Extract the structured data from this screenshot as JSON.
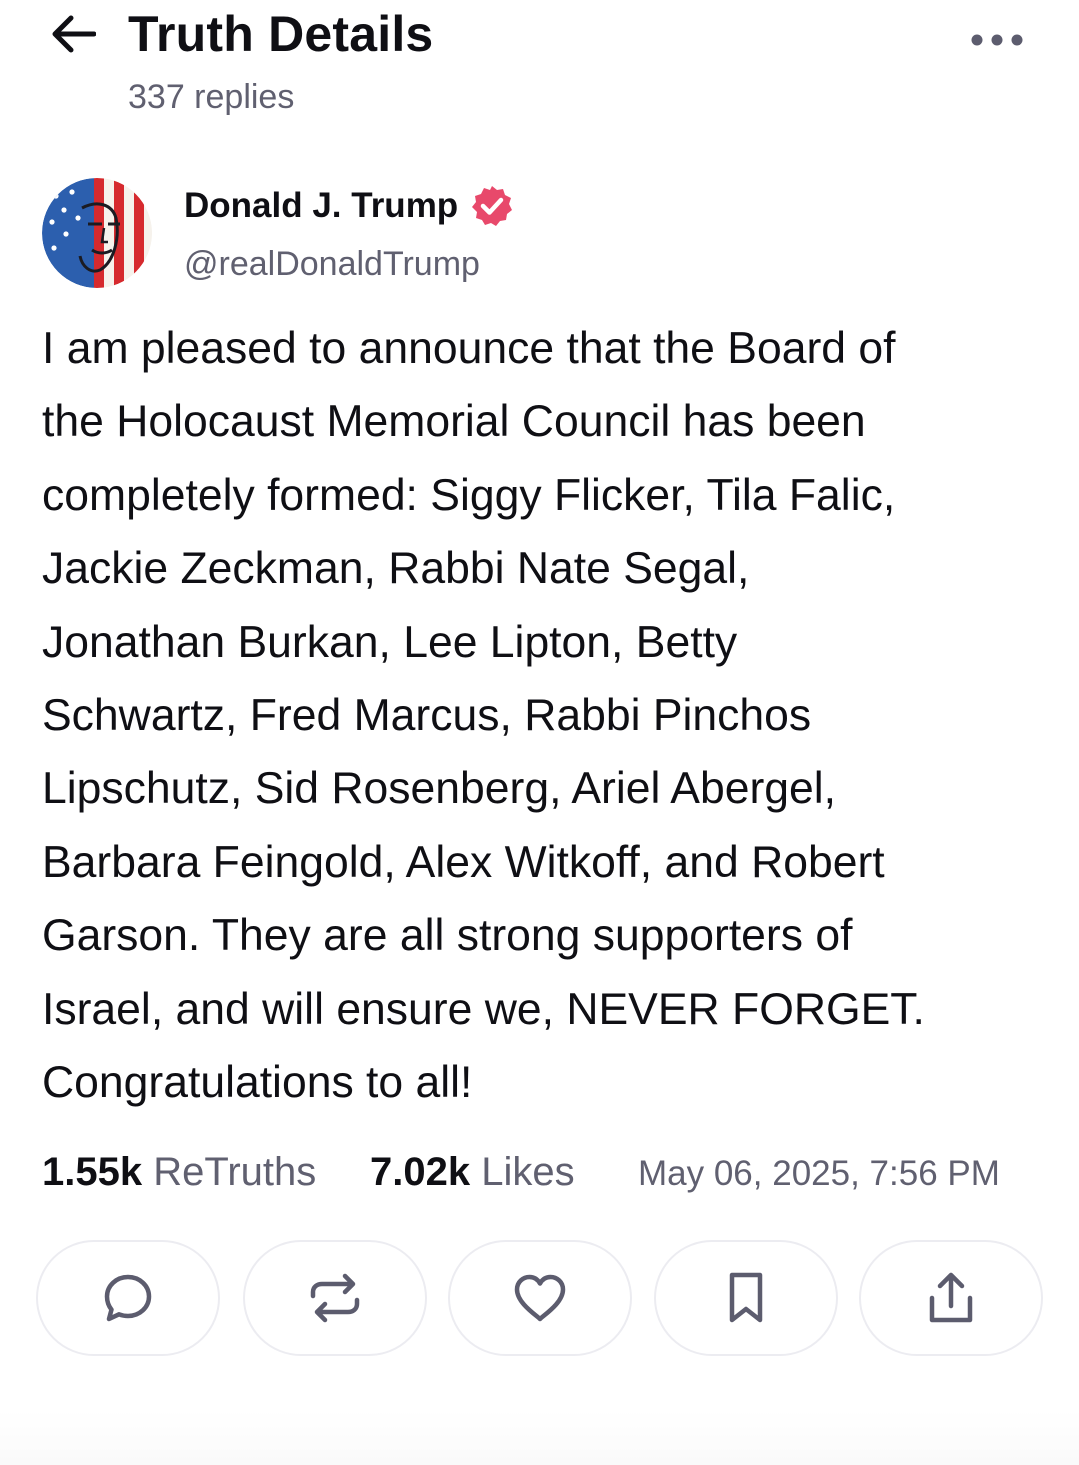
{
  "header": {
    "back_icon": "arrow-left-icon",
    "title": "Truth Details",
    "replies": "337 replies",
    "more_icon": "ellipsis-horizontal-icon"
  },
  "post": {
    "author": {
      "name": "Donald J. Trump",
      "handle": "@realDonaldTrump",
      "verified_icon": "verified-badge-icon",
      "verified_color": "#e8496b"
    },
    "body_lines": [
      "I am pleased to announce that the Board of",
      "the Holocaust Memorial Council has been",
      "completely formed: Siggy Flicker, Tila Falic,",
      "Jackie Zeckman, Rabbi Nate Segal,",
      "Jonathan Burkan, Lee Lipton, Betty",
      "Schwartz, Fred Marcus, Rabbi Pinchos",
      "Lipschutz, Sid Rosenberg, Ariel Abergel,",
      "Barbara Feingold, Alex Witkoff, and Robert",
      "Garson. They are all strong supporters of",
      "Israel, and will ensure we, NEVER FORGET.",
      "Congratulations to all!"
    ],
    "stats": {
      "retruths_count": "1.55k",
      "retruths_label": "ReTruths",
      "likes_count": "7.02k",
      "likes_label": "Likes"
    },
    "timestamp": "May 06, 2025, 7:56 PM"
  },
  "actions": [
    {
      "name": "reply-button",
      "icon": "comment-bubble-icon"
    },
    {
      "name": "retruth-button",
      "icon": "repost-arrows-icon"
    },
    {
      "name": "like-button",
      "icon": "heart-icon"
    },
    {
      "name": "bookmark-button",
      "icon": "bookmark-icon"
    },
    {
      "name": "share-button",
      "icon": "share-upload-icon"
    }
  ],
  "colors": {
    "text_primary": "#0f0f14",
    "text_secondary": "#606070",
    "button_border": "#ececf1",
    "icon_color": "#5c5c6e"
  }
}
